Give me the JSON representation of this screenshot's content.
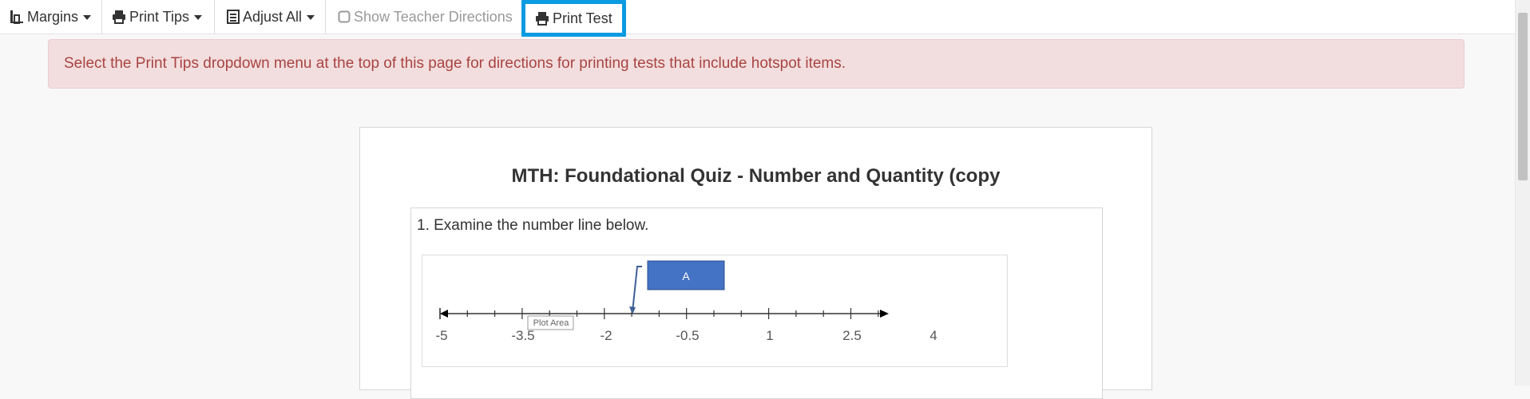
{
  "toolbar": {
    "margins": "Margins",
    "print_tips": "Print Tips",
    "adjust_all": "Adjust All",
    "show_teacher_directions": "Show Teacher Directions",
    "print_test": "Print Test"
  },
  "alert": {
    "text": "Select the Print Tips dropdown menu at the top of this page for directions for printing tests that include hotspot items."
  },
  "test": {
    "title": "MTH: Foundational Quiz - Number and Quantity (copy",
    "question_text": "1. Examine the number line below.",
    "number_line": {
      "tick_labels": [
        "-5",
        "-3.5",
        "-2",
        "-0.5",
        "1",
        "2.5",
        "4"
      ],
      "point_label": "A",
      "tooltip": "Plot Area"
    }
  },
  "colors": {
    "highlight": "#0a9be0",
    "alert_bg": "#f2dede",
    "alert_text": "#a94442",
    "point_box": "#4472c4"
  }
}
